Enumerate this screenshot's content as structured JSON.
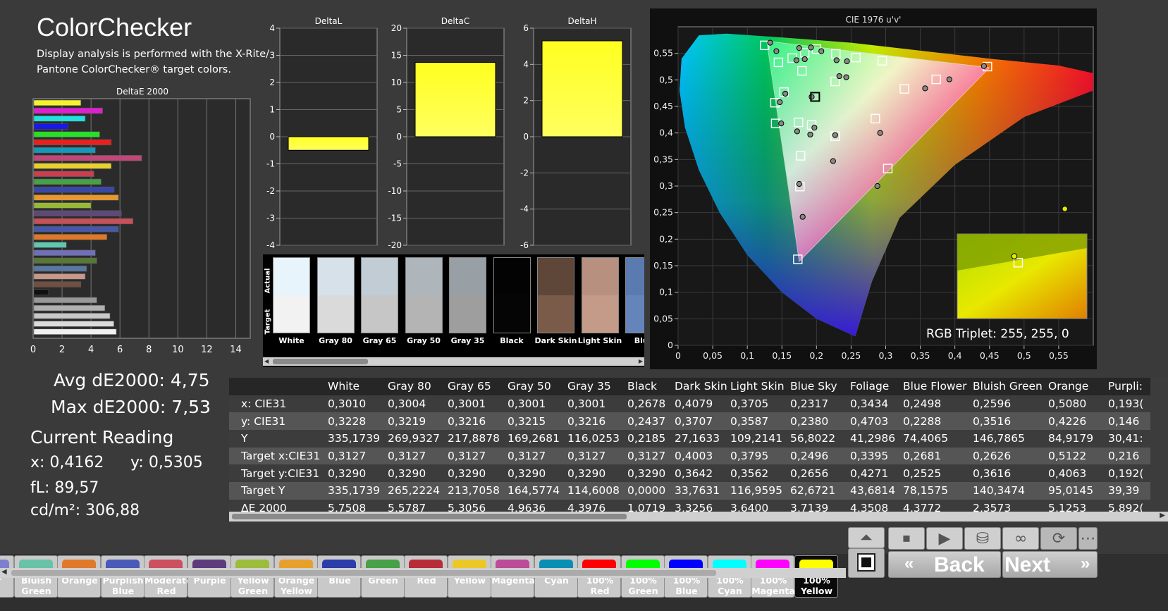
{
  "header": {
    "title": "ColorChecker",
    "subtitle": "Display analysis is performed with the X-Rite/ Pantone ColorChecker® target colors."
  },
  "stats": {
    "avg": "Avg dE2000: 4,75",
    "max": "Max dE2000: 7,53",
    "current_reading": "Current Reading",
    "x": "x: 0,4162",
    "y": "y: 0,5305",
    "fl": "fL: 89,57",
    "cdm2": "cd/m²: 306,88"
  },
  "deltae_chart": {
    "title": "DeltaE 2000",
    "xticks": [
      "0",
      "2",
      "4",
      "6",
      "8",
      "10",
      "12",
      "14"
    ],
    "bars": [
      {
        "value": 3.3,
        "color": "#f4f42c"
      },
      {
        "value": 4.8,
        "color": "#e020d0"
      },
      {
        "value": 3.6,
        "color": "#20e0e0"
      },
      {
        "value": 2.4,
        "color": "#1818e8"
      },
      {
        "value": 4.6,
        "color": "#28e028"
      },
      {
        "value": 5.4,
        "color": "#e82020"
      },
      {
        "value": 4.3,
        "color": "#1898b8"
      },
      {
        "value": 7.5,
        "color": "#c04878"
      },
      {
        "value": 5.4,
        "color": "#e8d030"
      },
      {
        "value": 4.2,
        "color": "#c84050"
      },
      {
        "value": 4.7,
        "color": "#48a048"
      },
      {
        "value": 5.6,
        "color": "#3848a8"
      },
      {
        "value": 5.9,
        "color": "#e89830"
      },
      {
        "value": 4.0,
        "color": "#98b838"
      },
      {
        "value": 6.1,
        "color": "#604878"
      },
      {
        "value": 6.9,
        "color": "#c85058"
      },
      {
        "value": 5.9,
        "color": "#4858a8"
      },
      {
        "value": 5.1,
        "color": "#e07828"
      },
      {
        "value": 2.3,
        "color": "#60c8b0"
      },
      {
        "value": 4.3,
        "color": "#7070b8"
      },
      {
        "value": 4.4,
        "color": "#587838"
      },
      {
        "value": 3.7,
        "color": "#5878a0"
      },
      {
        "value": 3.6,
        "color": "#c89888"
      },
      {
        "value": 3.3,
        "color": "#705040"
      },
      {
        "value": 1.07,
        "color": "#101010"
      },
      {
        "value": 4.4,
        "color": "#989898"
      },
      {
        "value": 4.96,
        "color": "#b0b0b0"
      },
      {
        "value": 5.31,
        "color": "#c8c8c8"
      },
      {
        "value": 5.58,
        "color": "#dcdcdc"
      },
      {
        "value": 5.75,
        "color": "#f0f0f0"
      }
    ]
  },
  "delta_l": {
    "title": "DeltaL",
    "ticks": [
      "4",
      "3",
      "2",
      "1",
      "0",
      "-1",
      "-2",
      "-3",
      "-4"
    ],
    "value": -0.5,
    "min": -4,
    "max": 4
  },
  "delta_c": {
    "title": "DeltaC",
    "ticks": [
      "20",
      "15",
      "10",
      "5",
      "0",
      "-5",
      "-10",
      "-15",
      "-20"
    ],
    "value": 13.7,
    "min": -20,
    "max": 20
  },
  "delta_h": {
    "title": "DeltaH",
    "ticks": [
      "6",
      "4",
      "2",
      "0",
      "-2",
      "-4",
      "-6"
    ],
    "value": 5.3,
    "min": -6,
    "max": 6
  },
  "swatches": {
    "actual_label": "Actual",
    "target_label": "Target",
    "items": [
      {
        "name": "White",
        "actual": "#e8f4fb",
        "target": "#f2f2f2"
      },
      {
        "name": "Gray 80",
        "actual": "#d6e1e9",
        "target": "#dadada"
      },
      {
        "name": "Gray 65",
        "actual": "#c2ccd4",
        "target": "#c6c6c6"
      },
      {
        "name": "Gray 50",
        "actual": "#aeb6bc",
        "target": "#b4b4b4"
      },
      {
        "name": "Gray 35",
        "actual": "#98a0a6",
        "target": "#9e9e9e"
      },
      {
        "name": "Black",
        "actual": "#030303",
        "target": "#050505"
      },
      {
        "name": "Dark Skin",
        "actual": "#5e4638",
        "target": "#7a5a48"
      },
      {
        "name": "Light Skin",
        "actual": "#b89080",
        "target": "#c49a88"
      },
      {
        "name": "Blue",
        "actual": "#5a7ab0",
        "target": "#6484ba"
      }
    ]
  },
  "cie": {
    "title": "CIE 1976 u'v'",
    "xticks": [
      "0",
      "0,05",
      "0,1",
      "0,15",
      "0,2",
      "0,25",
      "0,3",
      "0,35",
      "0,4",
      "0,45",
      "0,5",
      "0,55"
    ],
    "yticks": [
      "0,55",
      "0,5",
      "0,45",
      "0,4",
      "0,35",
      "0,3",
      "0,25",
      "0,2",
      "0,15",
      "0,1",
      "0,05",
      "0"
    ],
    "rgb_triplet": "RGB Triplet: 255, 255, 0",
    "targets": [
      [
        0.125,
        0.565
      ],
      [
        0.145,
        0.533
      ],
      [
        0.165,
        0.541
      ],
      [
        0.179,
        0.517
      ],
      [
        0.183,
        0.551
      ],
      [
        0.2,
        0.558
      ],
      [
        0.228,
        0.549
      ],
      [
        0.257,
        0.542
      ],
      [
        0.295,
        0.536
      ],
      [
        0.327,
        0.483
      ],
      [
        0.373,
        0.501
      ],
      [
        0.447,
        0.525
      ],
      [
        0.227,
        0.497
      ],
      [
        0.153,
        0.477
      ],
      [
        0.198,
        0.468
      ],
      [
        0.14,
        0.457
      ],
      [
        0.141,
        0.418
      ],
      [
        0.174,
        0.42
      ],
      [
        0.193,
        0.415
      ],
      [
        0.227,
        0.394
      ],
      [
        0.285,
        0.427
      ],
      [
        0.303,
        0.333
      ],
      [
        0.177,
        0.357
      ],
      [
        0.176,
        0.299
      ],
      [
        0.173,
        0.162
      ]
    ],
    "measured": [
      [
        0.133,
        0.57
      ],
      [
        0.142,
        0.554
      ],
      [
        0.175,
        0.56
      ],
      [
        0.171,
        0.537
      ],
      [
        0.183,
        0.539
      ],
      [
        0.192,
        0.561
      ],
      [
        0.207,
        0.554
      ],
      [
        0.229,
        0.537
      ],
      [
        0.244,
        0.535
      ],
      [
        0.233,
        0.507
      ],
      [
        0.243,
        0.505
      ],
      [
        0.357,
        0.484
      ],
      [
        0.392,
        0.501
      ],
      [
        0.442,
        0.526
      ],
      [
        0.155,
        0.474
      ],
      [
        0.193,
        0.468
      ],
      [
        0.147,
        0.458
      ],
      [
        0.149,
        0.418
      ],
      [
        0.172,
        0.403
      ],
      [
        0.191,
        0.397
      ],
      [
        0.197,
        0.41
      ],
      [
        0.227,
        0.396
      ],
      [
        0.292,
        0.4
      ],
      [
        0.224,
        0.347
      ],
      [
        0.175,
        0.304
      ],
      [
        0.18,
        0.242
      ],
      [
        0.288,
        0.3
      ]
    ],
    "zoom_points": {
      "target": [
        0.47,
        0.34
      ],
      "measured": [
        [
          0.44,
          0.93
        ],
        [
          0.83,
          0.37
        ]
      ]
    }
  },
  "table": {
    "columns": [
      "White",
      "Gray 80",
      "Gray 65",
      "Gray 50",
      "Gray 35",
      "Black",
      "Dark Skin",
      "Light Skin",
      "Blue Sky",
      "Foliage",
      "Blue Flower",
      "Bluish Green",
      "Orange",
      "Purpli:"
    ],
    "rows": [
      {
        "label": "x: CIE31",
        "values": [
          "0,3010",
          "0,3004",
          "0,3001",
          "0,3001",
          "0,3001",
          "0,2678",
          "0,4079",
          "0,3705",
          "0,2317",
          "0,3434",
          "0,2498",
          "0,2596",
          "0,5080",
          "0,193("
        ]
      },
      {
        "label": "y: CIE31",
        "values": [
          "0,3228",
          "0,3219",
          "0,3216",
          "0,3215",
          "0,3216",
          "0,2437",
          "0,3707",
          "0,3587",
          "0,2380",
          "0,4703",
          "0,2288",
          "0,3516",
          "0,4226",
          "0,146"
        ]
      },
      {
        "label": "Y",
        "values": [
          "335,1739",
          "269,9327",
          "217,8878",
          "169,2681",
          "116,0253",
          "0,2185",
          "27,1633",
          "109,2141",
          "56,8022",
          "41,2986",
          "74,4065",
          "146,7865",
          "84,9179",
          "30,41:"
        ]
      },
      {
        "label": "Target x:CIE31",
        "values": [
          "0,3127",
          "0,3127",
          "0,3127",
          "0,3127",
          "0,3127",
          "0,3127",
          "0,4003",
          "0,3795",
          "0,2496",
          "0,3395",
          "0,2681",
          "0,2626",
          "0,5122",
          "0,216"
        ]
      },
      {
        "label": "Target y:CIE31",
        "values": [
          "0,3290",
          "0,3290",
          "0,3290",
          "0,3290",
          "0,3290",
          "0,3290",
          "0,3642",
          "0,3562",
          "0,2656",
          "0,4271",
          "0,2525",
          "0,3616",
          "0,4063",
          "0,192("
        ]
      },
      {
        "label": "Target Y",
        "values": [
          "335,1739",
          "265,2224",
          "213,7058",
          "164,5774",
          "114,6008",
          "0,0000",
          "33,7631",
          "116,9595",
          "62,6721",
          "43,6814",
          "78,1575",
          "140,3474",
          "95,0145",
          "39,39"
        ]
      },
      {
        "label": "ΔE 2000",
        "values": [
          "5,7508",
          "5,5787",
          "5,3056",
          "4,9636",
          "4,3976",
          "1,0719",
          "3,3256",
          "3,6400",
          "3,7139",
          "4,3508",
          "4,3772",
          "2,3573",
          "5,1253",
          "5,892("
        ]
      }
    ]
  },
  "patches": [
    {
      "label": "ver",
      "color": "#7f7fd0"
    },
    {
      "label": "Bluish Green",
      "color": "#67c2a8"
    },
    {
      "label": "Orange",
      "color": "#e07a2a"
    },
    {
      "label": "Purplish Blue",
      "color": "#4a5ab8"
    },
    {
      "label": "Moderate Red",
      "color": "#cc5060"
    },
    {
      "label": "Purple",
      "color": "#5e3c7c"
    },
    {
      "label": "Yellow Green",
      "color": "#9cbc3c"
    },
    {
      "label": "Orange Yellow",
      "color": "#e8a02c"
    },
    {
      "label": "Blue",
      "color": "#2c3ca8"
    },
    {
      "label": "Green",
      "color": "#48a048"
    },
    {
      "label": "Red",
      "color": "#b82c38"
    },
    {
      "label": "Yellow",
      "color": "#ecc826"
    },
    {
      "label": "Magenta",
      "color": "#bc4c98"
    },
    {
      "label": "Cyan",
      "color": "#0890b4"
    },
    {
      "label": "100% Red",
      "color": "#ff0000"
    },
    {
      "label": "100% Green",
      "color": "#00ff00"
    },
    {
      "label": "100% Blue",
      "color": "#0000ff"
    },
    {
      "label": "100% Cyan",
      "color": "#00ffff"
    },
    {
      "label": "100% Magenta",
      "color": "#ff00ff"
    },
    {
      "label": "100% Yellow",
      "color": "#ffff00"
    }
  ],
  "nav": {
    "back": "Back",
    "next": "Next"
  }
}
